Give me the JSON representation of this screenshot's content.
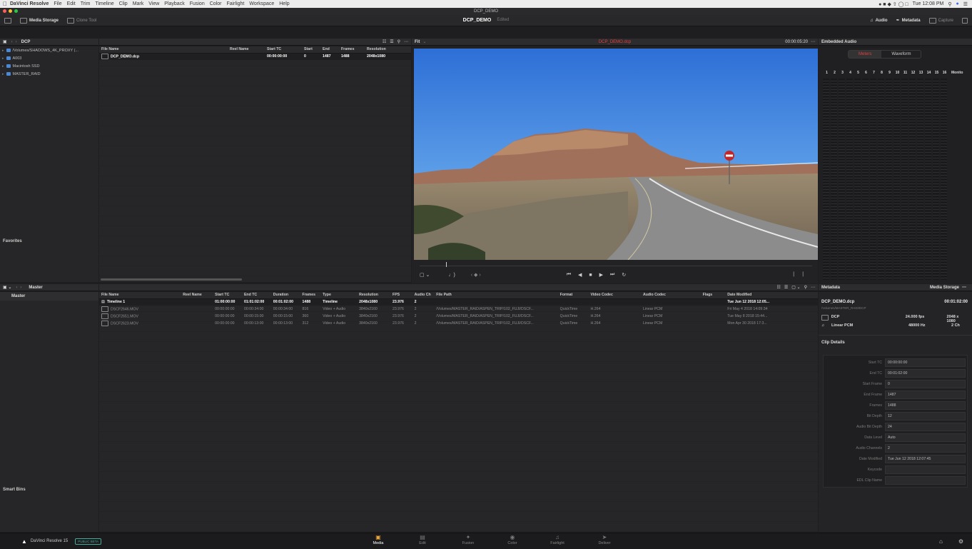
{
  "menubar": {
    "app": "DaVinci Resolve",
    "items": [
      "File",
      "Edit",
      "Trim",
      "Timeline",
      "Clip",
      "Mark",
      "View",
      "Playback",
      "Fusion",
      "Color",
      "Fairlight",
      "Workspace",
      "Help"
    ],
    "clock": "Tue 12:08 PM"
  },
  "window_title": "DCP_DEMO",
  "toolbar": {
    "media_storage": "Media Storage",
    "clone_tool": "Clone Tool",
    "project": "DCP_DEMO",
    "project_state": "Edited",
    "audio": "Audio",
    "metadata": "Metadata",
    "capture": "Capture"
  },
  "media_storage": {
    "location": "DCP",
    "volumes": [
      "/Volumes/SHADOWS_4K_PROXY (...",
      "A003",
      "Macintosh SSD",
      "MASTER_RAID"
    ],
    "favorites": "Favorites",
    "columns": [
      "File Name",
      "Reel Name",
      "Start TC",
      "Start",
      "End",
      "Frames",
      "Resolution"
    ],
    "files": [
      {
        "name": "DCP_DEMO.dcp",
        "reel": "",
        "start_tc": "00:00:00:00",
        "start": "0",
        "end": "1487",
        "frames": "1488",
        "res": "2048x1080"
      }
    ]
  },
  "viewer": {
    "zoom": "Fit",
    "clip_name": "DCP_DEMO.dcp",
    "timecode": "00:00:05:20",
    "playhead_fraction": 0.0
  },
  "audio_panel": {
    "title": "Embedded Audio",
    "tab_meters": "Meters",
    "tab_waveform": "Waveform",
    "channels": [
      "1",
      "2",
      "3",
      "4",
      "5",
      "6",
      "7",
      "8",
      "9",
      "10",
      "11",
      "12",
      "13",
      "14",
      "15",
      "16"
    ],
    "monitor": "Monito"
  },
  "media_pool": {
    "bin_name": "Master",
    "bins": [
      "Master"
    ],
    "smart_bins": "Smart Bins",
    "columns": [
      "File Name",
      "Reel Name",
      "Start TC",
      "End TC",
      "Duration",
      "Frames",
      "Type",
      "Resolution",
      "FPS",
      "Audio Ch",
      "File Path",
      "Format",
      "Video Codec",
      "Audio Codec",
      "Flags",
      "Date Modified"
    ],
    "clips": [
      {
        "name": "Timeline 1",
        "reel": "",
        "start": "01:00:00:00",
        "end": "01:01:02:00",
        "dur": "00:01:02:00",
        "frames": "1488",
        "type": "Timeline",
        "res": "2048x1080",
        "fps": "23.976",
        "ach": "2",
        "path": "",
        "format": "",
        "vcodec": "",
        "acodec": "",
        "flags": "",
        "date": "Tue Jun 12 2018 12:05..."
      },
      {
        "name": "DSCF2646.MOV",
        "reel": "",
        "start": "00:00:00:00",
        "end": "00:00:34:00",
        "dur": "00:00:34:00",
        "frames": "816",
        "type": "Video + Audio",
        "res": "3840x2160",
        "fps": "23.976",
        "ach": "2",
        "path": "/Volumes/MASTER_RAID/ASPEN_TRIP/102_FUJI/DSCF...",
        "format": "QuickTime",
        "vcodec": "H.264",
        "acodec": "Linear PCM",
        "flags": "",
        "date": "Fri May 4 2018 14:09:34"
      },
      {
        "name": "DSCF2651.MOV",
        "reel": "",
        "start": "00:00:00:00",
        "end": "00:00:15:00",
        "dur": "00:00:15:00",
        "frames": "360",
        "type": "Video + Audio",
        "res": "3840x2160",
        "fps": "23.976",
        "ach": "2",
        "path": "/Volumes/MASTER_RAID/ASPEN_TRIP/102_FUJI/DSCF...",
        "format": "QuickTime",
        "vcodec": "H.264",
        "acodec": "Linear PCM",
        "flags": "",
        "date": "Tue May 8 2018 15:44..."
      },
      {
        "name": "DSCF2623.MOV",
        "reel": "",
        "start": "00:00:00:00",
        "end": "00:00:13:00",
        "dur": "00:00:13:00",
        "frames": "312",
        "type": "Video + Audio",
        "res": "3840x2160",
        "fps": "23.976",
        "ach": "2",
        "path": "/Volumes/MASTER_RAID/ASPEN_TRIP/102_FUJI/DSCF...",
        "format": "QuickTime",
        "vcodec": "H.264",
        "acodec": "Linear PCM",
        "flags": "",
        "date": "Mon Apr 30 2018 17:3..."
      }
    ]
  },
  "metadata_panel": {
    "title": "Metadata",
    "mode": "Media Storage",
    "clip_name": "DCP_DEMO.dcp",
    "clip_path": "/Volumes/MASTER_RAID/DCP",
    "clip_duration": "00:01:02:00",
    "video_label": "DCP",
    "fps": "24.000 fps",
    "resolution": "2048 x 1080",
    "audio_label": "Linear PCM",
    "sample_rate": "48000 Hz",
    "channels": "2 Ch",
    "details_title": "Clip Details",
    "details": [
      {
        "k": "Start TC",
        "v": "00:00:00:00"
      },
      {
        "k": "End TC",
        "v": "00:01:02:00"
      },
      {
        "k": "Start Frame",
        "v": "0"
      },
      {
        "k": "End Frame",
        "v": "1487"
      },
      {
        "k": "Frames",
        "v": "1488"
      },
      {
        "k": "Bit Depth",
        "v": "12"
      },
      {
        "k": "Audio Bit Depth",
        "v": "24"
      },
      {
        "k": "Data Level",
        "v": "Auto"
      },
      {
        "k": "Audio Channels",
        "v": "2"
      },
      {
        "k": "Date Modified",
        "v": "Tue Jun 12 2018 12:07:45"
      },
      {
        "k": "Keycode",
        "v": ""
      },
      {
        "k": "EDL Clip Name",
        "v": ""
      }
    ]
  },
  "dock": {
    "product": "DaVinci Resolve 15",
    "badge": "PUBLIC BETA",
    "pages": [
      "Media",
      "Edit",
      "Fusion",
      "Color",
      "Fairlight",
      "Deliver"
    ],
    "active_page": "Media"
  },
  "colors": {
    "accent_orange": "#e7a43a",
    "clip_name_red": "#e04040",
    "volume_blue": "#4a88d8"
  }
}
